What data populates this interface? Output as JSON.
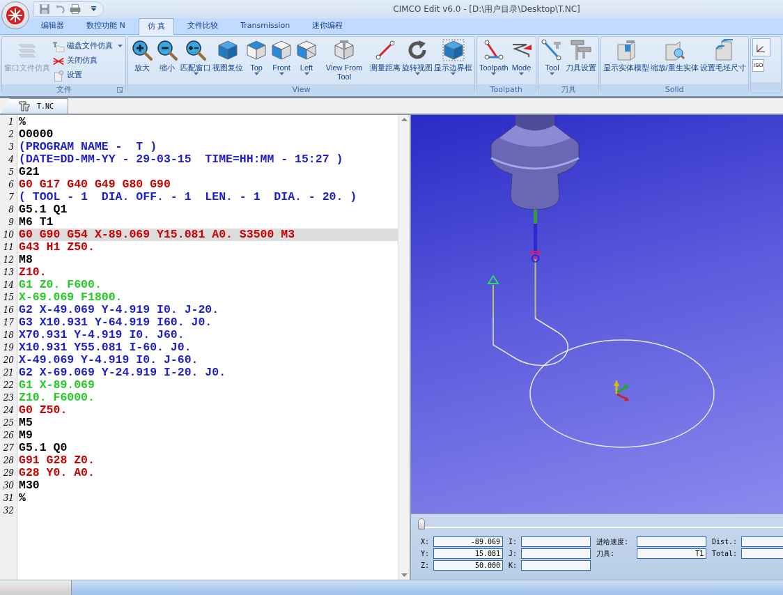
{
  "window": {
    "title": "CIMCO Edit v6.0 - [D:\\用户目录\\Desktop\\T.NC]"
  },
  "tabs": [
    {
      "label": "编辑器",
      "selected": false
    },
    {
      "label": "数控功能 N",
      "selected": false
    },
    {
      "label": "仿 真",
      "selected": true
    },
    {
      "label": "文件比较",
      "selected": false
    },
    {
      "label": "Transmission",
      "selected": false
    },
    {
      "label": "迷你编程",
      "selected": false
    }
  ],
  "ribbon": {
    "groups": [
      {
        "title": "文件",
        "launcher": true,
        "buttons": [
          {
            "label": "窗口文件仿真",
            "kind": "large",
            "dropdown": false,
            "disabled": true
          },
          {
            "label": "磁盘文件仿真",
            "kind": "small",
            "dropdown": true,
            "disabled": false
          },
          {
            "label": "关闭仿真",
            "kind": "small",
            "dropdown": false,
            "disabled": false
          },
          {
            "label": "设置",
            "kind": "small",
            "dropdown": false,
            "disabled": false
          }
        ]
      },
      {
        "title": "View",
        "launcher": false,
        "buttons": [
          {
            "label": "放大",
            "kind": "large",
            "dropdown": false,
            "disabled": false
          },
          {
            "label": "缩小",
            "kind": "large",
            "dropdown": false,
            "disabled": false
          },
          {
            "label": "匹配窗口",
            "kind": "large",
            "dropdown": true,
            "disabled": false
          },
          {
            "label": "视图复位",
            "kind": "large",
            "dropdown": false,
            "disabled": false
          },
          {
            "label": "Top",
            "kind": "large",
            "dropdown": true,
            "disabled": false
          },
          {
            "label": "Front",
            "kind": "large",
            "dropdown": true,
            "disabled": false
          },
          {
            "label": "Left",
            "kind": "large",
            "dropdown": true,
            "disabled": false
          },
          {
            "label": "View From Tool",
            "kind": "large",
            "dropdown": false,
            "disabled": false
          },
          {
            "label": "测量距离",
            "kind": "large",
            "dropdown": false,
            "disabled": false
          },
          {
            "label": "旋转视图",
            "kind": "large",
            "dropdown": true,
            "disabled": false
          },
          {
            "label": "显示边界框",
            "kind": "large",
            "dropdown": true,
            "disabled": false
          }
        ]
      },
      {
        "title": "Toolpath",
        "launcher": false,
        "buttons": [
          {
            "label": "Toolpath",
            "kind": "large",
            "dropdown": true,
            "disabled": false
          },
          {
            "label": "Mode",
            "kind": "large",
            "dropdown": true,
            "disabled": false
          }
        ]
      },
      {
        "title": "刀具",
        "launcher": false,
        "buttons": [
          {
            "label": "Tool",
            "kind": "large",
            "dropdown": true,
            "disabled": false
          },
          {
            "label": "刀具设置",
            "kind": "large",
            "dropdown": false,
            "disabled": false
          }
        ]
      },
      {
        "title": "Solid",
        "launcher": false,
        "buttons": [
          {
            "label": "显示实体模型",
            "kind": "large",
            "dropdown": false,
            "disabled": false
          },
          {
            "label": "缩放/重生实体",
            "kind": "large",
            "dropdown": false,
            "disabled": false
          },
          {
            "label": "设置毛坯尺寸",
            "kind": "large",
            "dropdown": false,
            "disabled": false
          }
        ]
      },
      {
        "launcher": false,
        "buttons": [
          {
            "kind": "icon"
          }
        ],
        "field": "ISO"
      }
    ]
  },
  "document_tabs": [
    {
      "label": "T.NC",
      "selected": true
    }
  ],
  "editor": {
    "lines": [
      {
        "number": "1",
        "text": "%",
        "color": "#000000",
        "selected": false
      },
      {
        "number": "2",
        "text": "O0000",
        "color": "#000000",
        "selected": false
      },
      {
        "number": "3",
        "text": "(PROGRAM NAME -  T )",
        "color": "#1c1cd0",
        "selected": false
      },
      {
        "number": "4",
        "text": "(DATE=DD-MM-YY - 29-03-15  TIME=HH:MM - 15:27 )",
        "color": "#1c1cd0",
        "selected": false
      },
      {
        "number": "5",
        "text": "G21",
        "color": "#000000",
        "selected": false
      },
      {
        "number": "6",
        "text": "G0 G17 G40 G49 G80 G90",
        "color": "#cc0000",
        "selected": false
      },
      {
        "number": "7",
        "text": "( TOOL - 1  DIA. OFF. - 1  LEN. - 1  DIA. - 20. )",
        "color": "#1c1cd0",
        "selected": false
      },
      {
        "number": "8",
        "text": "G5.1 Q1",
        "color": "#000000",
        "selected": false
      },
      {
        "number": "9",
        "text": "M6 T1",
        "color": "#000000",
        "selected": false
      },
      {
        "number": "10",
        "text": "G0 G90 G54 X-89.069 Y15.081 A0. S3500 M3",
        "color": "#cc0000",
        "selected": true
      },
      {
        "number": "11",
        "text": "G43 H1 Z50.",
        "color": "#cc0000",
        "selected": false
      },
      {
        "number": "12",
        "text": "M8",
        "color": "#000000",
        "selected": false
      },
      {
        "number": "13",
        "text": "Z10.",
        "color": "#cc0000",
        "selected": false
      },
      {
        "number": "14",
        "text": "G1 Z0. F600.",
        "color": "#22cc22",
        "selected": false
      },
      {
        "number": "15",
        "text": "X-69.069 F1800.",
        "color": "#22cc22",
        "selected": false
      },
      {
        "number": "16",
        "text": "G2 X-49.069 Y-4.919 I0. J-20.",
        "color": "#1c1cd0",
        "selected": false
      },
      {
        "number": "17",
        "text": "G3 X10.931 Y-64.919 I60. J0.",
        "color": "#1c1cd0",
        "selected": false
      },
      {
        "number": "18",
        "text": "X70.931 Y-4.919 I0. J60.",
        "color": "#1c1cd0",
        "selected": false
      },
      {
        "number": "19",
        "text": "X10.931 Y55.081 I-60. J0.",
        "color": "#1c1cd0",
        "selected": false
      },
      {
        "number": "20",
        "text": "X-49.069 Y-4.919 I0. J-60.",
        "color": "#1c1cd0",
        "selected": false
      },
      {
        "number": "21",
        "text": "G2 X-69.069 Y-24.919 I-20. J0.",
        "color": "#1c1cd0",
        "selected": false
      },
      {
        "number": "22",
        "text": "G1 X-89.069",
        "color": "#22cc22",
        "selected": false
      },
      {
        "number": "23",
        "text": "Z10. F6000.",
        "color": "#22cc22",
        "selected": false
      },
      {
        "number": "24",
        "text": "G0 Z50.",
        "color": "#cc0000",
        "selected": false
      },
      {
        "number": "25",
        "text": "M5",
        "color": "#000000",
        "selected": false
      },
      {
        "number": "26",
        "text": "M9",
        "color": "#000000",
        "selected": false
      },
      {
        "number": "27",
        "text": "G5.1 Q0",
        "color": "#000000",
        "selected": false
      },
      {
        "number": "28",
        "text": "G91 G28 Z0.",
        "color": "#cc0000",
        "selected": false
      },
      {
        "number": "29",
        "text": "G28 Y0. A0.",
        "color": "#cc0000",
        "selected": false
      },
      {
        "number": "30",
        "text": "M30",
        "color": "#000000",
        "selected": false
      },
      {
        "number": "31",
        "text": "%",
        "color": "#000000",
        "selected": false
      },
      {
        "number": "32",
        "selected": false
      }
    ]
  },
  "position_panel": {
    "slider": {
      "level": 0
    },
    "columns": [
      [
        {
          "label": "X:",
          "value": "-89.069"
        },
        {
          "label": "Y:",
          "value": "15.081"
        },
        {
          "label": "Z:",
          "value": "50.000"
        }
      ],
      [
        {
          "label": "I:"
        },
        {
          "label": "J:"
        },
        {
          "label": "K:"
        }
      ],
      [
        {
          "label": "进给速度:"
        },
        {
          "label": "刀具:",
          "value": "T1"
        }
      ],
      [
        {
          "label": "Dist.:"
        },
        {
          "label": "Total:"
        }
      ]
    ]
  }
}
